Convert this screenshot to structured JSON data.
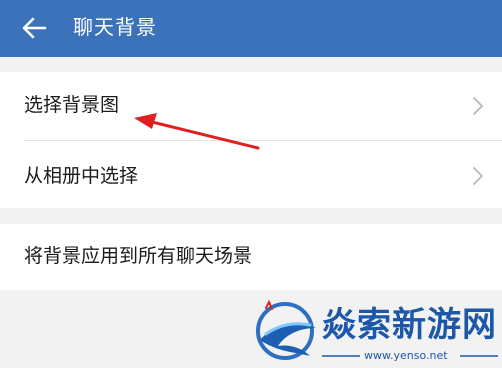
{
  "header": {
    "title": "聊天背景",
    "back_icon": "arrow-left-icon",
    "bg_color": "#3c72b9"
  },
  "settings": {
    "items": [
      {
        "label": "选择背景图",
        "icon": "chevron-right-icon"
      },
      {
        "label": "从相册中选择",
        "icon": "chevron-right-icon"
      },
      {
        "label": "将背景应用到所有聊天场景"
      }
    ]
  },
  "annotation": {
    "arrow_color": "#e02020"
  },
  "watermark": {
    "name": "焱索新游网",
    "url": "www.yenso.net",
    "logo_icon": "blue-swirl-logo-icon"
  }
}
